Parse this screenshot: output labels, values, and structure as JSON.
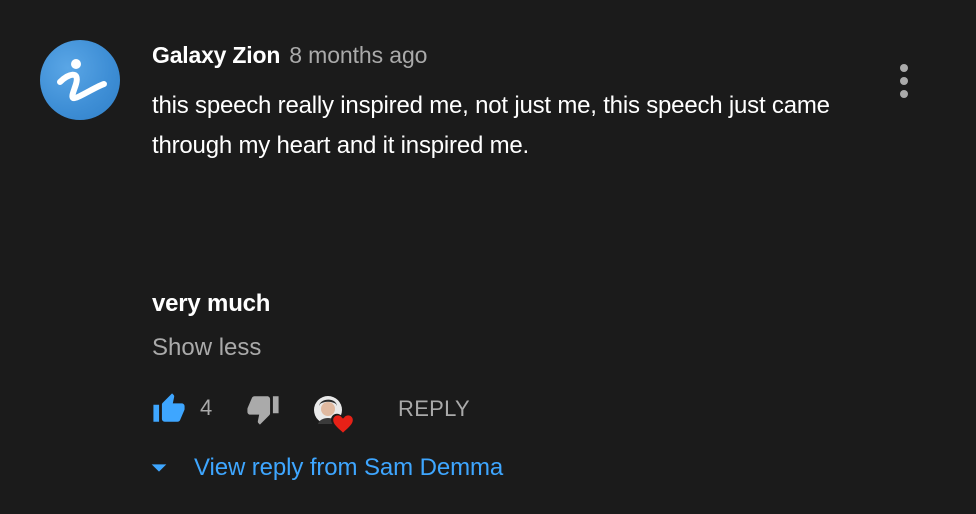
{
  "comment": {
    "author": "Galaxy Zion",
    "timestamp": "8 months ago",
    "avatar_icon": "letter-i-icon",
    "avatar_color": "#3f8fd6",
    "text": "this speech really inspired me, not just me, this speech just came through my heart and it inspired me.",
    "text_extra": "very much",
    "show_less_label": "Show less",
    "likes": "4",
    "reply_label": "REPLY",
    "view_replies_label": "View reply from Sam Demma"
  },
  "colors": {
    "background": "#1b1b1b",
    "accent": "#3ea6ff",
    "like_active": "#3ea6ff",
    "muted": "#aaaaaa",
    "heart": "#e62117"
  },
  "icons": {
    "like": "thumbs-up-icon",
    "dislike": "thumbs-down-icon",
    "creator_heart": "heart-icon",
    "menu": "more-vert-icon",
    "expand": "caret-down-icon"
  }
}
